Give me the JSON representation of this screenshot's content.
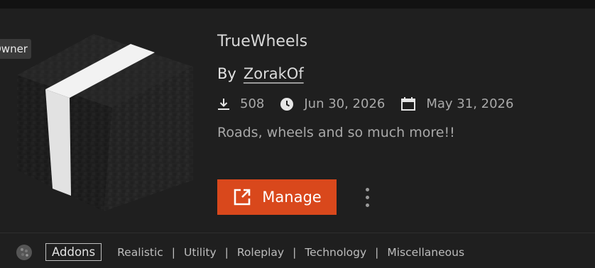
{
  "owner_tag": "Owner",
  "project": {
    "title": "TrueWheels",
    "author_prefix": "By",
    "author": "ZorakOf",
    "downloads": "508",
    "created": "Jun 30, 2026",
    "updated": "May 31, 2026",
    "description": "Roads, wheels and so much more!!"
  },
  "actions": {
    "manage_label": "Manage",
    "more_icon": "vertical-ellipsis-icon"
  },
  "footer": {
    "category": "Addons",
    "tags": [
      "Realistic",
      "Utility",
      "Roleplay",
      "Technology",
      "Miscellaneous"
    ]
  },
  "icons": {
    "downloads": "download-icon",
    "created": "clock-icon",
    "updated": "calendar-icon",
    "manage": "external-link-icon",
    "category": "block-icon"
  },
  "colors": {
    "accent": "#d9481c",
    "background": "#1f1f1f",
    "muted_text": "#a9a9a9"
  }
}
